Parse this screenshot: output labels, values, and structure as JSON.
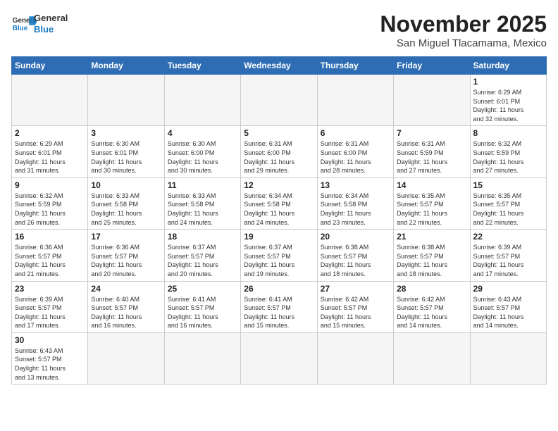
{
  "header": {
    "logo_general": "General",
    "logo_blue": "Blue",
    "month_title": "November 2025",
    "subtitle": "San Miguel Tlacamama, Mexico"
  },
  "weekdays": [
    "Sunday",
    "Monday",
    "Tuesday",
    "Wednesday",
    "Thursday",
    "Friday",
    "Saturday"
  ],
  "days": [
    {
      "date": "",
      "info": ""
    },
    {
      "date": "",
      "info": ""
    },
    {
      "date": "",
      "info": ""
    },
    {
      "date": "",
      "info": ""
    },
    {
      "date": "",
      "info": ""
    },
    {
      "date": "",
      "info": ""
    },
    {
      "date": "1",
      "info": "Sunrise: 6:29 AM\nSunset: 6:01 PM\nDaylight: 11 hours\nand 32 minutes."
    },
    {
      "date": "2",
      "info": "Sunrise: 6:29 AM\nSunset: 6:01 PM\nDaylight: 11 hours\nand 31 minutes."
    },
    {
      "date": "3",
      "info": "Sunrise: 6:30 AM\nSunset: 6:01 PM\nDaylight: 11 hours\nand 30 minutes."
    },
    {
      "date": "4",
      "info": "Sunrise: 6:30 AM\nSunset: 6:00 PM\nDaylight: 11 hours\nand 30 minutes."
    },
    {
      "date": "5",
      "info": "Sunrise: 6:31 AM\nSunset: 6:00 PM\nDaylight: 11 hours\nand 29 minutes."
    },
    {
      "date": "6",
      "info": "Sunrise: 6:31 AM\nSunset: 6:00 PM\nDaylight: 11 hours\nand 28 minutes."
    },
    {
      "date": "7",
      "info": "Sunrise: 6:31 AM\nSunset: 5:59 PM\nDaylight: 11 hours\nand 27 minutes."
    },
    {
      "date": "8",
      "info": "Sunrise: 6:32 AM\nSunset: 5:59 PM\nDaylight: 11 hours\nand 27 minutes."
    },
    {
      "date": "9",
      "info": "Sunrise: 6:32 AM\nSunset: 5:59 PM\nDaylight: 11 hours\nand 26 minutes."
    },
    {
      "date": "10",
      "info": "Sunrise: 6:33 AM\nSunset: 5:58 PM\nDaylight: 11 hours\nand 25 minutes."
    },
    {
      "date": "11",
      "info": "Sunrise: 6:33 AM\nSunset: 5:58 PM\nDaylight: 11 hours\nand 24 minutes."
    },
    {
      "date": "12",
      "info": "Sunrise: 6:34 AM\nSunset: 5:58 PM\nDaylight: 11 hours\nand 24 minutes."
    },
    {
      "date": "13",
      "info": "Sunrise: 6:34 AM\nSunset: 5:58 PM\nDaylight: 11 hours\nand 23 minutes."
    },
    {
      "date": "14",
      "info": "Sunrise: 6:35 AM\nSunset: 5:57 PM\nDaylight: 11 hours\nand 22 minutes."
    },
    {
      "date": "15",
      "info": "Sunrise: 6:35 AM\nSunset: 5:57 PM\nDaylight: 11 hours\nand 22 minutes."
    },
    {
      "date": "16",
      "info": "Sunrise: 6:36 AM\nSunset: 5:57 PM\nDaylight: 11 hours\nand 21 minutes."
    },
    {
      "date": "17",
      "info": "Sunrise: 6:36 AM\nSunset: 5:57 PM\nDaylight: 11 hours\nand 20 minutes."
    },
    {
      "date": "18",
      "info": "Sunrise: 6:37 AM\nSunset: 5:57 PM\nDaylight: 11 hours\nand 20 minutes."
    },
    {
      "date": "19",
      "info": "Sunrise: 6:37 AM\nSunset: 5:57 PM\nDaylight: 11 hours\nand 19 minutes."
    },
    {
      "date": "20",
      "info": "Sunrise: 6:38 AM\nSunset: 5:57 PM\nDaylight: 11 hours\nand 18 minutes."
    },
    {
      "date": "21",
      "info": "Sunrise: 6:38 AM\nSunset: 5:57 PM\nDaylight: 11 hours\nand 18 minutes."
    },
    {
      "date": "22",
      "info": "Sunrise: 6:39 AM\nSunset: 5:57 PM\nDaylight: 11 hours\nand 17 minutes."
    },
    {
      "date": "23",
      "info": "Sunrise: 6:39 AM\nSunset: 5:57 PM\nDaylight: 11 hours\nand 17 minutes."
    },
    {
      "date": "24",
      "info": "Sunrise: 6:40 AM\nSunset: 5:57 PM\nDaylight: 11 hours\nand 16 minutes."
    },
    {
      "date": "25",
      "info": "Sunrise: 6:41 AM\nSunset: 5:57 PM\nDaylight: 11 hours\nand 16 minutes."
    },
    {
      "date": "26",
      "info": "Sunrise: 6:41 AM\nSunset: 5:57 PM\nDaylight: 11 hours\nand 15 minutes."
    },
    {
      "date": "27",
      "info": "Sunrise: 6:42 AM\nSunset: 5:57 PM\nDaylight: 11 hours\nand 15 minutes."
    },
    {
      "date": "28",
      "info": "Sunrise: 6:42 AM\nSunset: 5:57 PM\nDaylight: 11 hours\nand 14 minutes."
    },
    {
      "date": "29",
      "info": "Sunrise: 6:43 AM\nSunset: 5:57 PM\nDaylight: 11 hours\nand 14 minutes."
    },
    {
      "date": "30",
      "info": "Sunrise: 6:43 AM\nSunset: 5:57 PM\nDaylight: 11 hours\nand 13 minutes."
    },
    {
      "date": "",
      "info": ""
    },
    {
      "date": "",
      "info": ""
    },
    {
      "date": "",
      "info": ""
    },
    {
      "date": "",
      "info": ""
    },
    {
      "date": "",
      "info": ""
    },
    {
      "date": "",
      "info": ""
    }
  ]
}
